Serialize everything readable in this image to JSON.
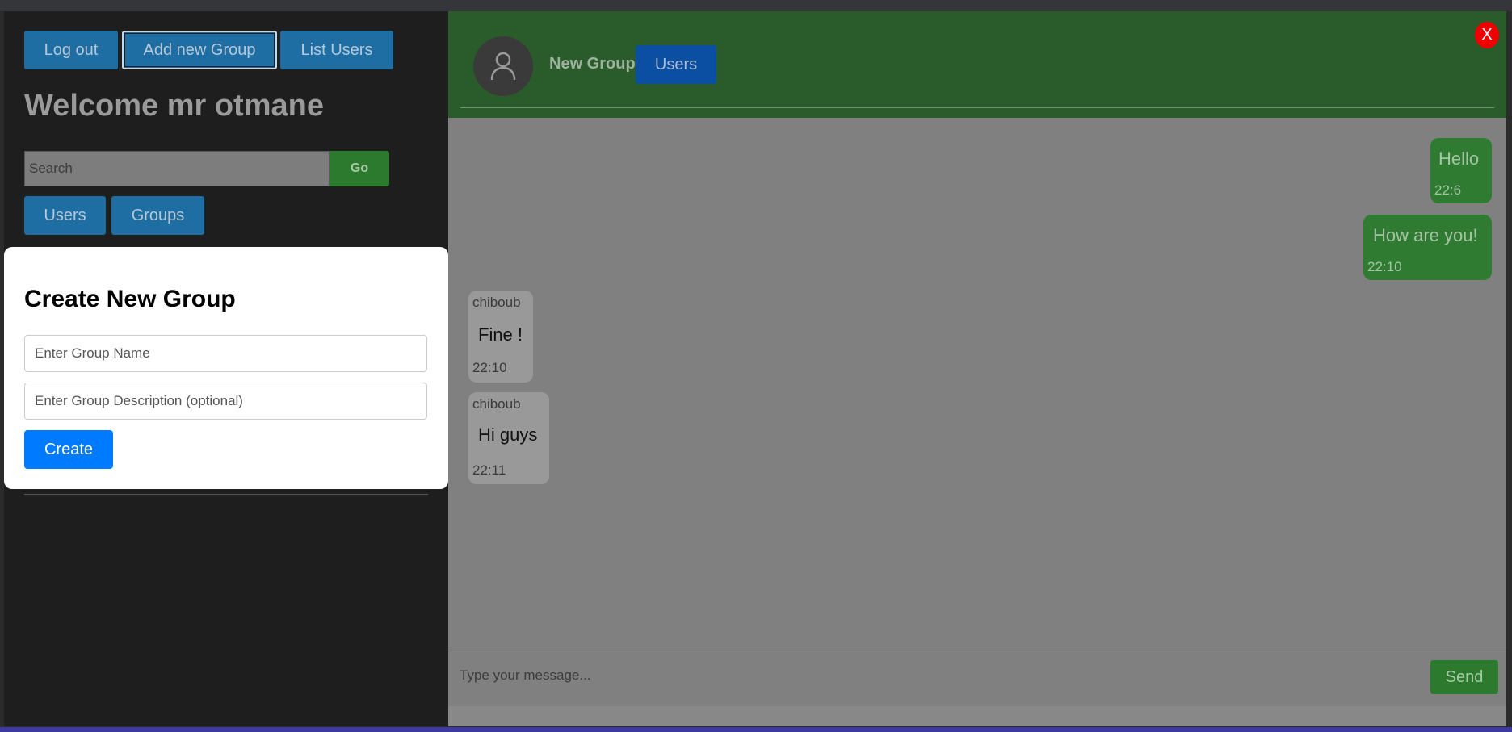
{
  "sidebar": {
    "logout_label": "Log out",
    "add_group_label": "Add new Group",
    "list_users_label": "List Users",
    "welcome": "Welcome mr otmane",
    "search_placeholder": "Search",
    "go_label": "Go",
    "users_tab": "Users",
    "groups_tab": "Groups"
  },
  "chat": {
    "group_name": "New Group",
    "users_button": "Users",
    "close_label": "X",
    "messages": [
      {
        "direction": "out",
        "text": "Hello",
        "time": "22:6"
      },
      {
        "direction": "out",
        "text": "How are you!",
        "time": "22:10"
      },
      {
        "direction": "in",
        "sender": "chiboub",
        "text": "Fine !",
        "time": "22:10"
      },
      {
        "direction": "in",
        "sender": "chiboub",
        "text": "Hi guys",
        "time": "22:11"
      }
    ],
    "message_placeholder": "Type your message...",
    "send_label": "Send"
  },
  "modal": {
    "title": "Create New Group",
    "name_placeholder": "Enter Group Name",
    "description_placeholder": "Enter Group Description (optional)",
    "create_label": "Create"
  },
  "colors": {
    "header_green": "#2a5b2b",
    "bubble_green": "#2f7b31",
    "primary_blue": "#007bff",
    "close_red": "#ee0000"
  }
}
